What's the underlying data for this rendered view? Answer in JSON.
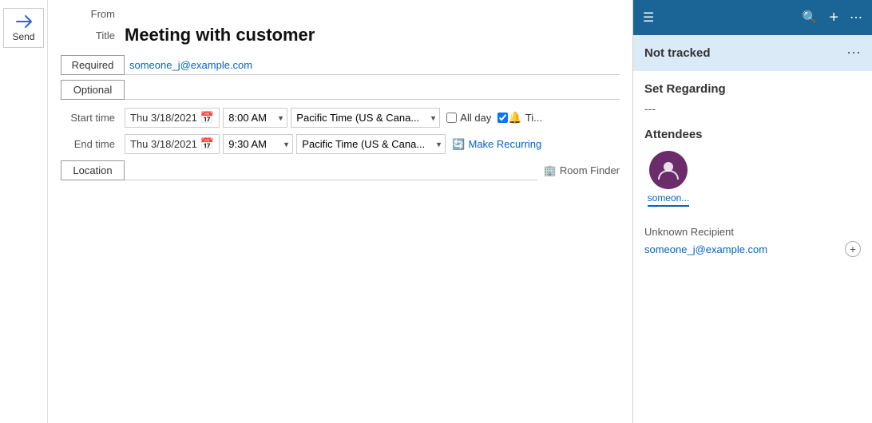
{
  "send_button": {
    "label": "Send",
    "arrow": "➤"
  },
  "form": {
    "from_label": "From",
    "title_label": "Title",
    "title_value": "Meeting with customer",
    "required_label": "Required",
    "optional_label": "Optional",
    "required_email": "someone_j@example.com",
    "optional_email": "",
    "start_time_label": "Start time",
    "start_date": "Thu 3/18/2021",
    "start_time": "8:00 AM",
    "end_time_label": "End time",
    "end_date": "Thu 3/18/2021",
    "end_time": "9:30 AM",
    "timezone": "Pacific Time (US & Cana...",
    "allday_label": "All day",
    "reminder_label": "Ti...",
    "recurring_label": "Make Recurring",
    "location_label": "Location",
    "location_value": "",
    "room_finder_label": "Room Finder"
  },
  "sidebar": {
    "menu_icon": "☰",
    "search_icon": "🔍",
    "add_icon": "+",
    "more_icon": "⋯",
    "not_tracked_label": "Not tracked",
    "not_tracked_menu": "⋯",
    "set_regarding_label": "Set Regarding",
    "regarding_value": "---",
    "attendees_label": "Attendees",
    "attendee_name": "someon...",
    "attendee_icon": "👤",
    "unknown_recipient_label": "Unknown Recipient",
    "recipient_email": "someone_j@example.com",
    "add_recipient_icon": "+"
  }
}
